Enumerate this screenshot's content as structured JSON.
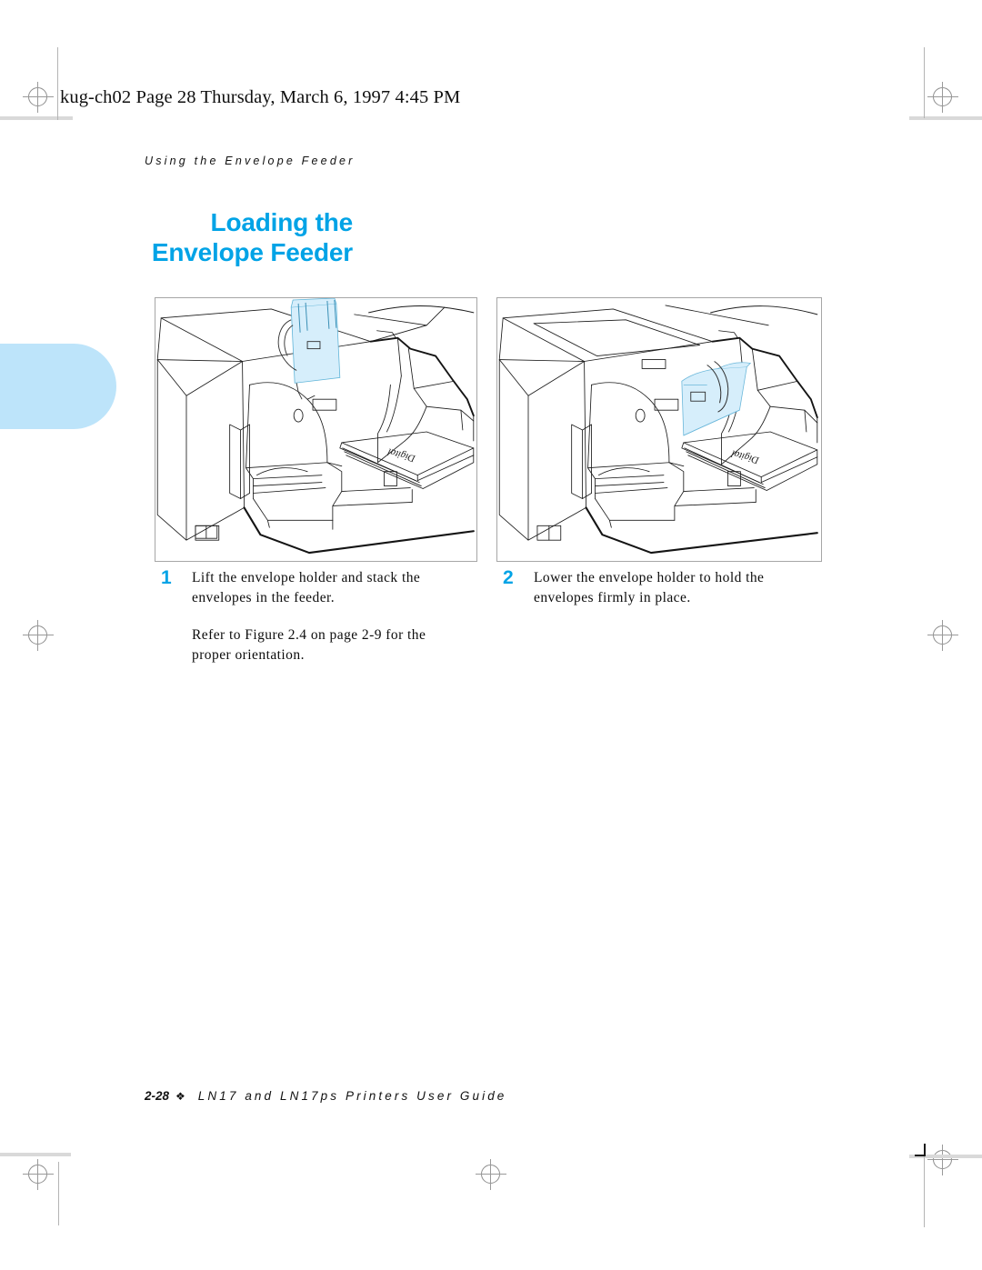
{
  "page": {
    "header_line": "kug-ch02  Page 28  Thursday, March 6, 1997  4:45 PM",
    "running_head": "Using the Envelope Feeder",
    "accent_color": "#00a3e6",
    "tab_color": "#bde4fa"
  },
  "title": {
    "line1": "Loading the",
    "line2": "Envelope Feeder"
  },
  "figures": [
    {
      "id": "figure-1",
      "caption_hint": "Printer with envelope holder lifted and envelopes stacked in feeder",
      "highlight_color": "#d6eefb",
      "stack_label": "Digital"
    },
    {
      "id": "figure-2",
      "caption_hint": "Printer with envelope holder lowered onto the envelope stack",
      "highlight_color": "#d6eefb",
      "stack_label": "Digital"
    }
  ],
  "steps": [
    {
      "number": "1",
      "paragraphs": [
        "Lift the envelope holder and stack the envelopes in the feeder.",
        "Refer to Figure 2.4 on page 2-9 for the proper orientation."
      ]
    },
    {
      "number": "2",
      "paragraphs": [
        "Lower the envelope holder to hold the envelopes firmly in place."
      ]
    }
  ],
  "footer": {
    "page_number": "2-28",
    "separator": "❖",
    "guide_title": "LN17 and LN17ps Printers User Guide"
  }
}
